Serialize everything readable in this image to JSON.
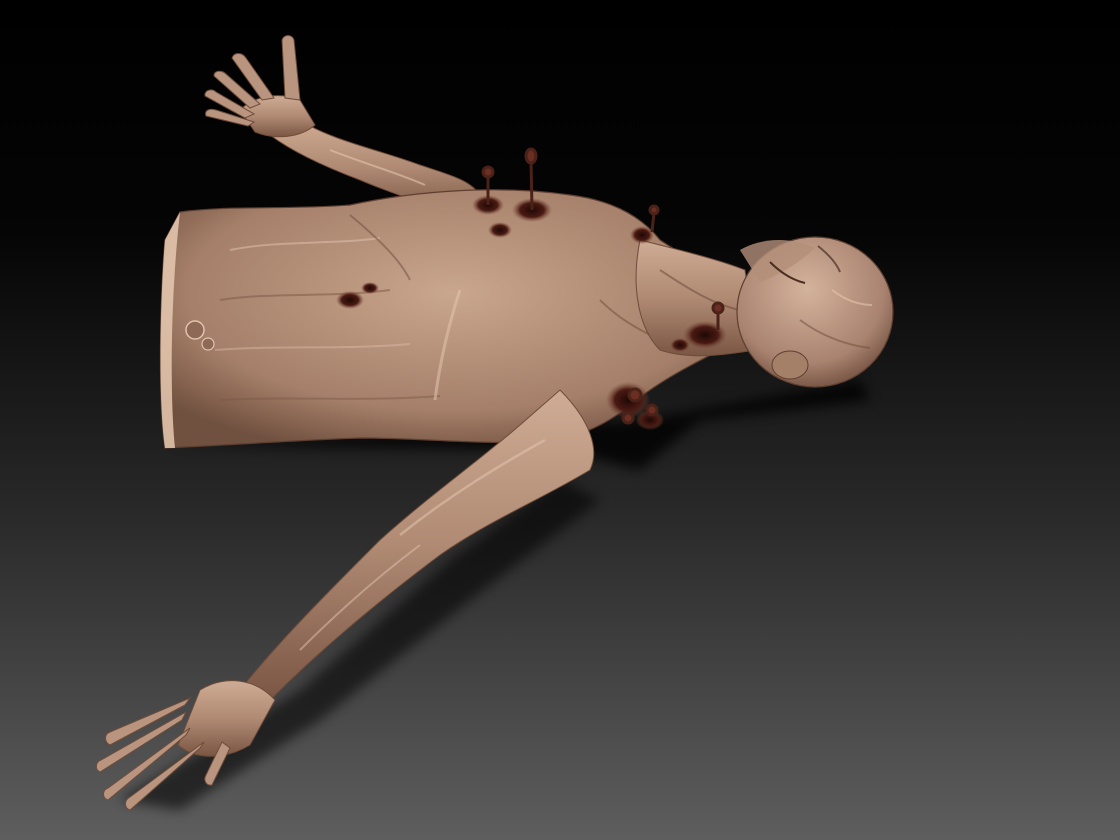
{
  "scene": {
    "kind": "3d-sculpt-render",
    "subject": "decaying-human-torso-lying-on-back",
    "colors": {
      "background_top": "#000000",
      "background_bottom": "#5e5e5e",
      "skin_base": "#b08a73",
      "skin_light": "#d8b7a0",
      "skin_shadow": "#6e4c3a",
      "wound": "#3a1410",
      "blood": "#5a1810"
    }
  }
}
